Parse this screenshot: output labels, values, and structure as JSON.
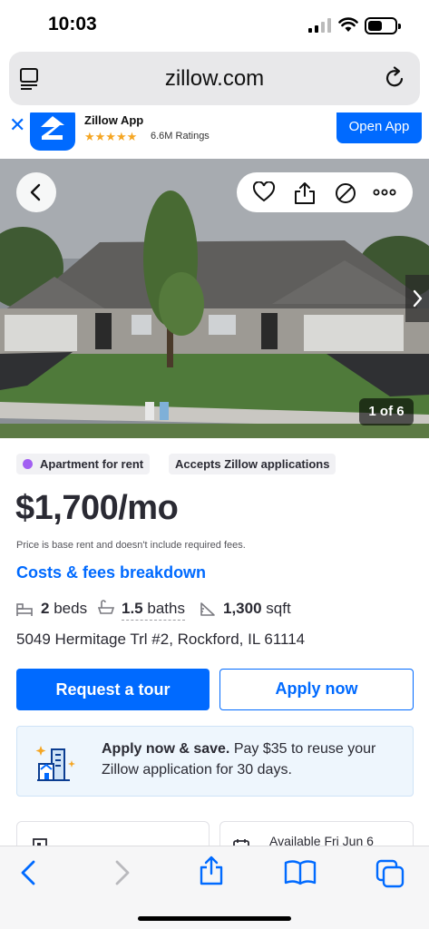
{
  "status_bar": {
    "time": "10:03"
  },
  "browser": {
    "url": "zillow.com"
  },
  "app_banner": {
    "app_name": "Zillow App",
    "stars": "★★★★★",
    "ratings": "6.6M Ratings",
    "open_label": "Open App"
  },
  "photo": {
    "counter": "1 of 6"
  },
  "tags": {
    "type": "Apartment for rent",
    "applications": "Accepts Zillow applications"
  },
  "listing": {
    "price": "$1,700/mo",
    "price_note": "Price is base rent and doesn't include required fees.",
    "costs_link": "Costs & fees breakdown",
    "beds_num": "2",
    "beds_label": "beds",
    "baths_num": "1.5",
    "baths_label": "baths",
    "sqft_num": "1,300",
    "sqft_label": "sqft",
    "address": "5049 Hermitage Trl #2, Rockford, IL 61114"
  },
  "buttons": {
    "tour": "Request a tour",
    "apply": "Apply now"
  },
  "promo": {
    "bold": "Apply now & save.",
    "text": " Pay $35 to reuse your Zillow application for 30 days."
  },
  "cards": {
    "availability": "Available Fri Jun 6"
  },
  "colors": {
    "zillow_blue": "#006aff",
    "tag_dot": "#a25ff2"
  }
}
